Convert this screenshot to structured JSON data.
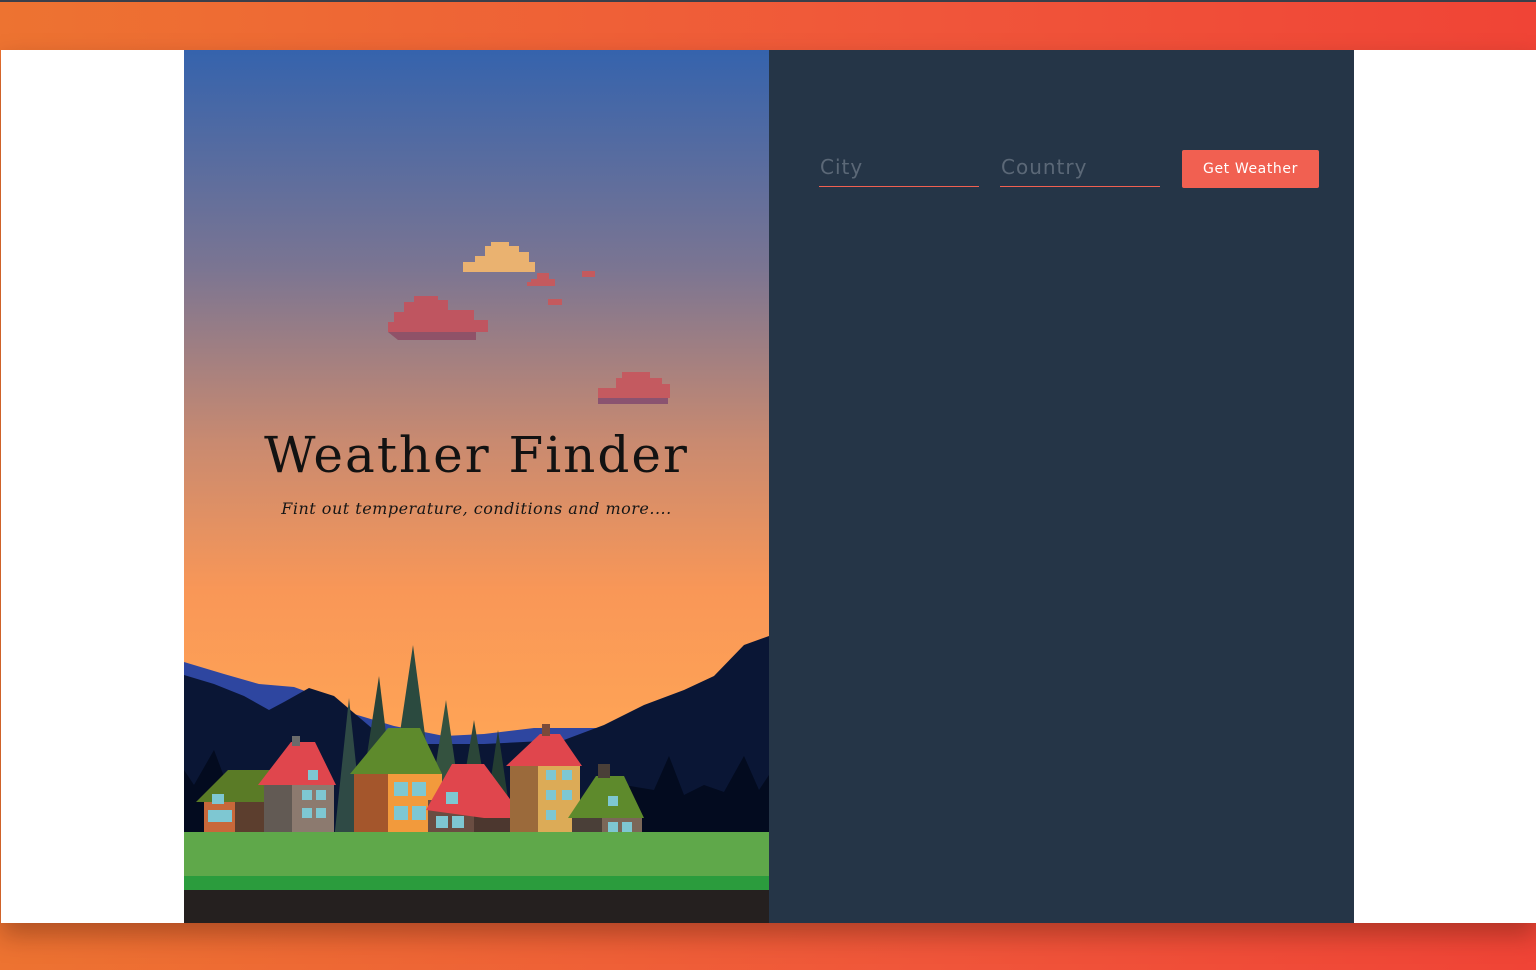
{
  "title_panel": {
    "title": "Weather Finder",
    "subtitle": "Fint out temperature, conditions and more...."
  },
  "form": {
    "city_placeholder": "City",
    "city_value": "",
    "country_placeholder": "Country",
    "country_value": "",
    "submit_label": "Get Weather"
  },
  "colors": {
    "page_gradient_start": "#ed7331",
    "page_gradient_end": "#f04436",
    "form_panel_bg": "#253547",
    "accent": "#f16051",
    "sky_top": "#3563ad",
    "sky_bottom": "#ffa556"
  }
}
